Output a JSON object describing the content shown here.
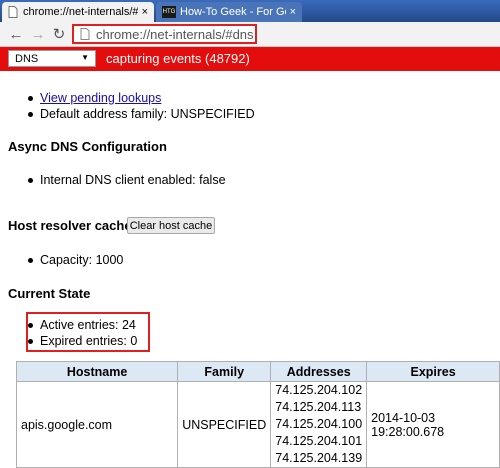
{
  "tabs": [
    {
      "title": "chrome://net-internals/#d",
      "close": "×"
    },
    {
      "title": "How-To Geek - For Geeks",
      "badge": "HTG",
      "close": "×"
    }
  ],
  "toolbar": {
    "back": "←",
    "forward": "→",
    "reload": "↻",
    "url": "chrome://net-internals/#dns"
  },
  "statusbar": {
    "selected_view": "DNS",
    "capture_text": "capturing events (48792)",
    "color": "#e30d0d"
  },
  "dns": {
    "pending_link": "View pending lookups",
    "address_family": "Default address family: UNSPECIFIED",
    "async_heading": "Async DNS Configuration",
    "internal_client": "Internal DNS client enabled: false",
    "cache_heading": "Host resolver cache",
    "clear_button": "Clear host cache",
    "capacity": "Capacity: 1000",
    "state_heading": "Current State",
    "active_entries": "Active entries: 24",
    "expired_entries": "Expired entries: 0"
  },
  "table": {
    "headers": [
      "Hostname",
      "Family",
      "Addresses",
      "Expires"
    ],
    "rows": [
      {
        "hostname": "apis.google.com",
        "family": "UNSPECIFIED",
        "addresses": [
          "74.125.204.102",
          "74.125.204.113",
          "74.125.204.100",
          "74.125.204.101",
          "74.125.204.139"
        ],
        "expires": "2014-10-03 19:28:00.678"
      }
    ]
  }
}
